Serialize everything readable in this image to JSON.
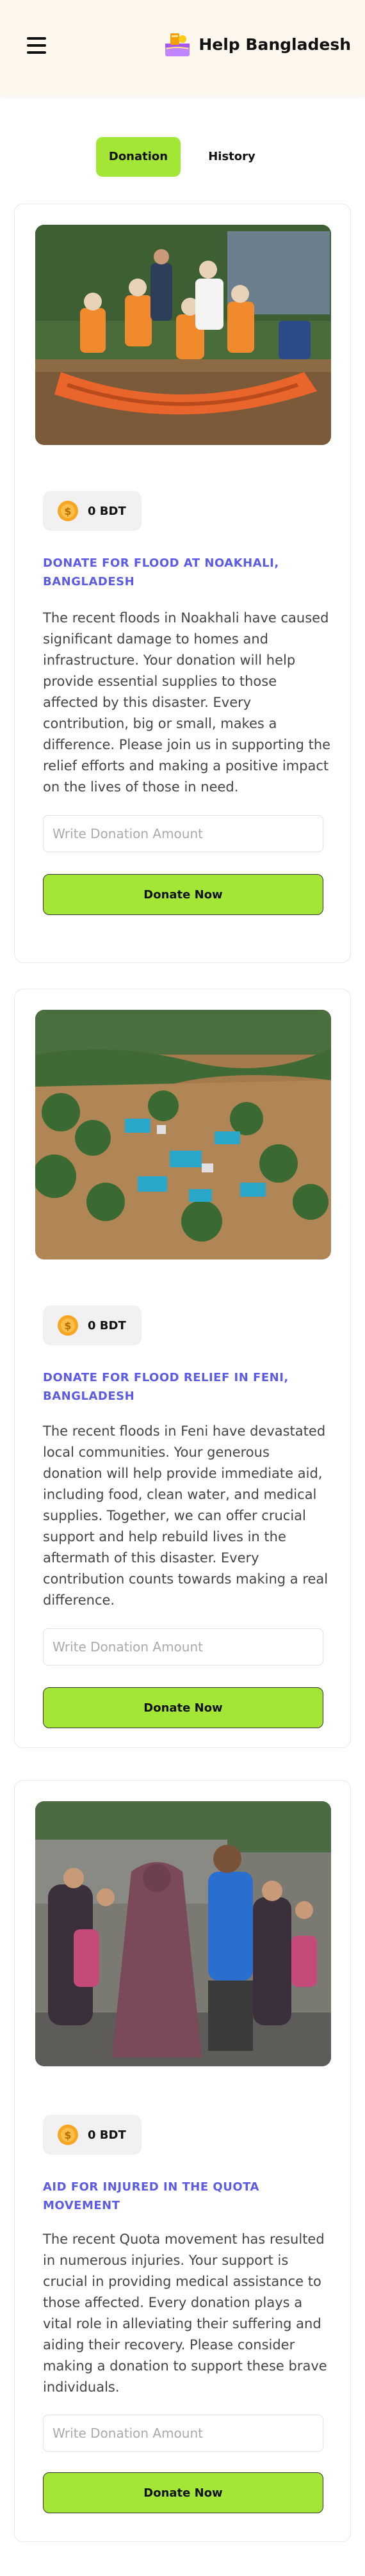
{
  "header": {
    "brand_name": "Help Bangladesh",
    "logo_icon": "donation-box-logo",
    "menu_icon": "hamburger-menu-icon"
  },
  "tabs": [
    {
      "label": "Donation",
      "active": true
    },
    {
      "label": "History",
      "active": false
    }
  ],
  "cards": [
    {
      "amount": "0 BDT",
      "title": "DONATE FOR FLOOD AT NOAKHALI, BANGLADESH",
      "description": "The recent floods in Noakhali have caused significant damage to homes and infrastructure. Your donation will help provide essential supplies to those affected by this disaster. Every contribution, big or small, makes a difference. Please join us in supporting the relief efforts and making a positive impact on the lives of those in need.",
      "input_placeholder": "Write Donation Amount",
      "button_label": "Donate Now"
    },
    {
      "amount": "0 BDT",
      "title": "DONATE FOR FLOOD RELIEF IN FENI, BANGLADESH",
      "description": "The recent floods in Feni have devastated local communities. Your generous donation will help provide immediate aid, including food, clean water, and medical supplies. Together, we can offer crucial support and help rebuild lives in the aftermath of this disaster. Every contribution counts towards making a real difference.",
      "input_placeholder": "Write Donation Amount",
      "button_label": "Donate Now"
    },
    {
      "amount": "0 BDT",
      "title": "AID FOR INJURED IN THE QUOTA MOVEMENT",
      "description": "The recent Quota movement has resulted in numerous injuries. Your support is crucial in providing medical assistance to those affected. Every donation plays a vital role in alleviating their suffering and aiding their recovery. Please consider making a donation to support these brave individuals.",
      "input_placeholder": "Write Donation Amount",
      "button_label": "Donate Now"
    }
  ],
  "colors": {
    "accent_green": "#a3e635",
    "title_purple": "#5b5be6",
    "coin_gold": "#f5a623",
    "header_bg": "#fdf7ee"
  }
}
